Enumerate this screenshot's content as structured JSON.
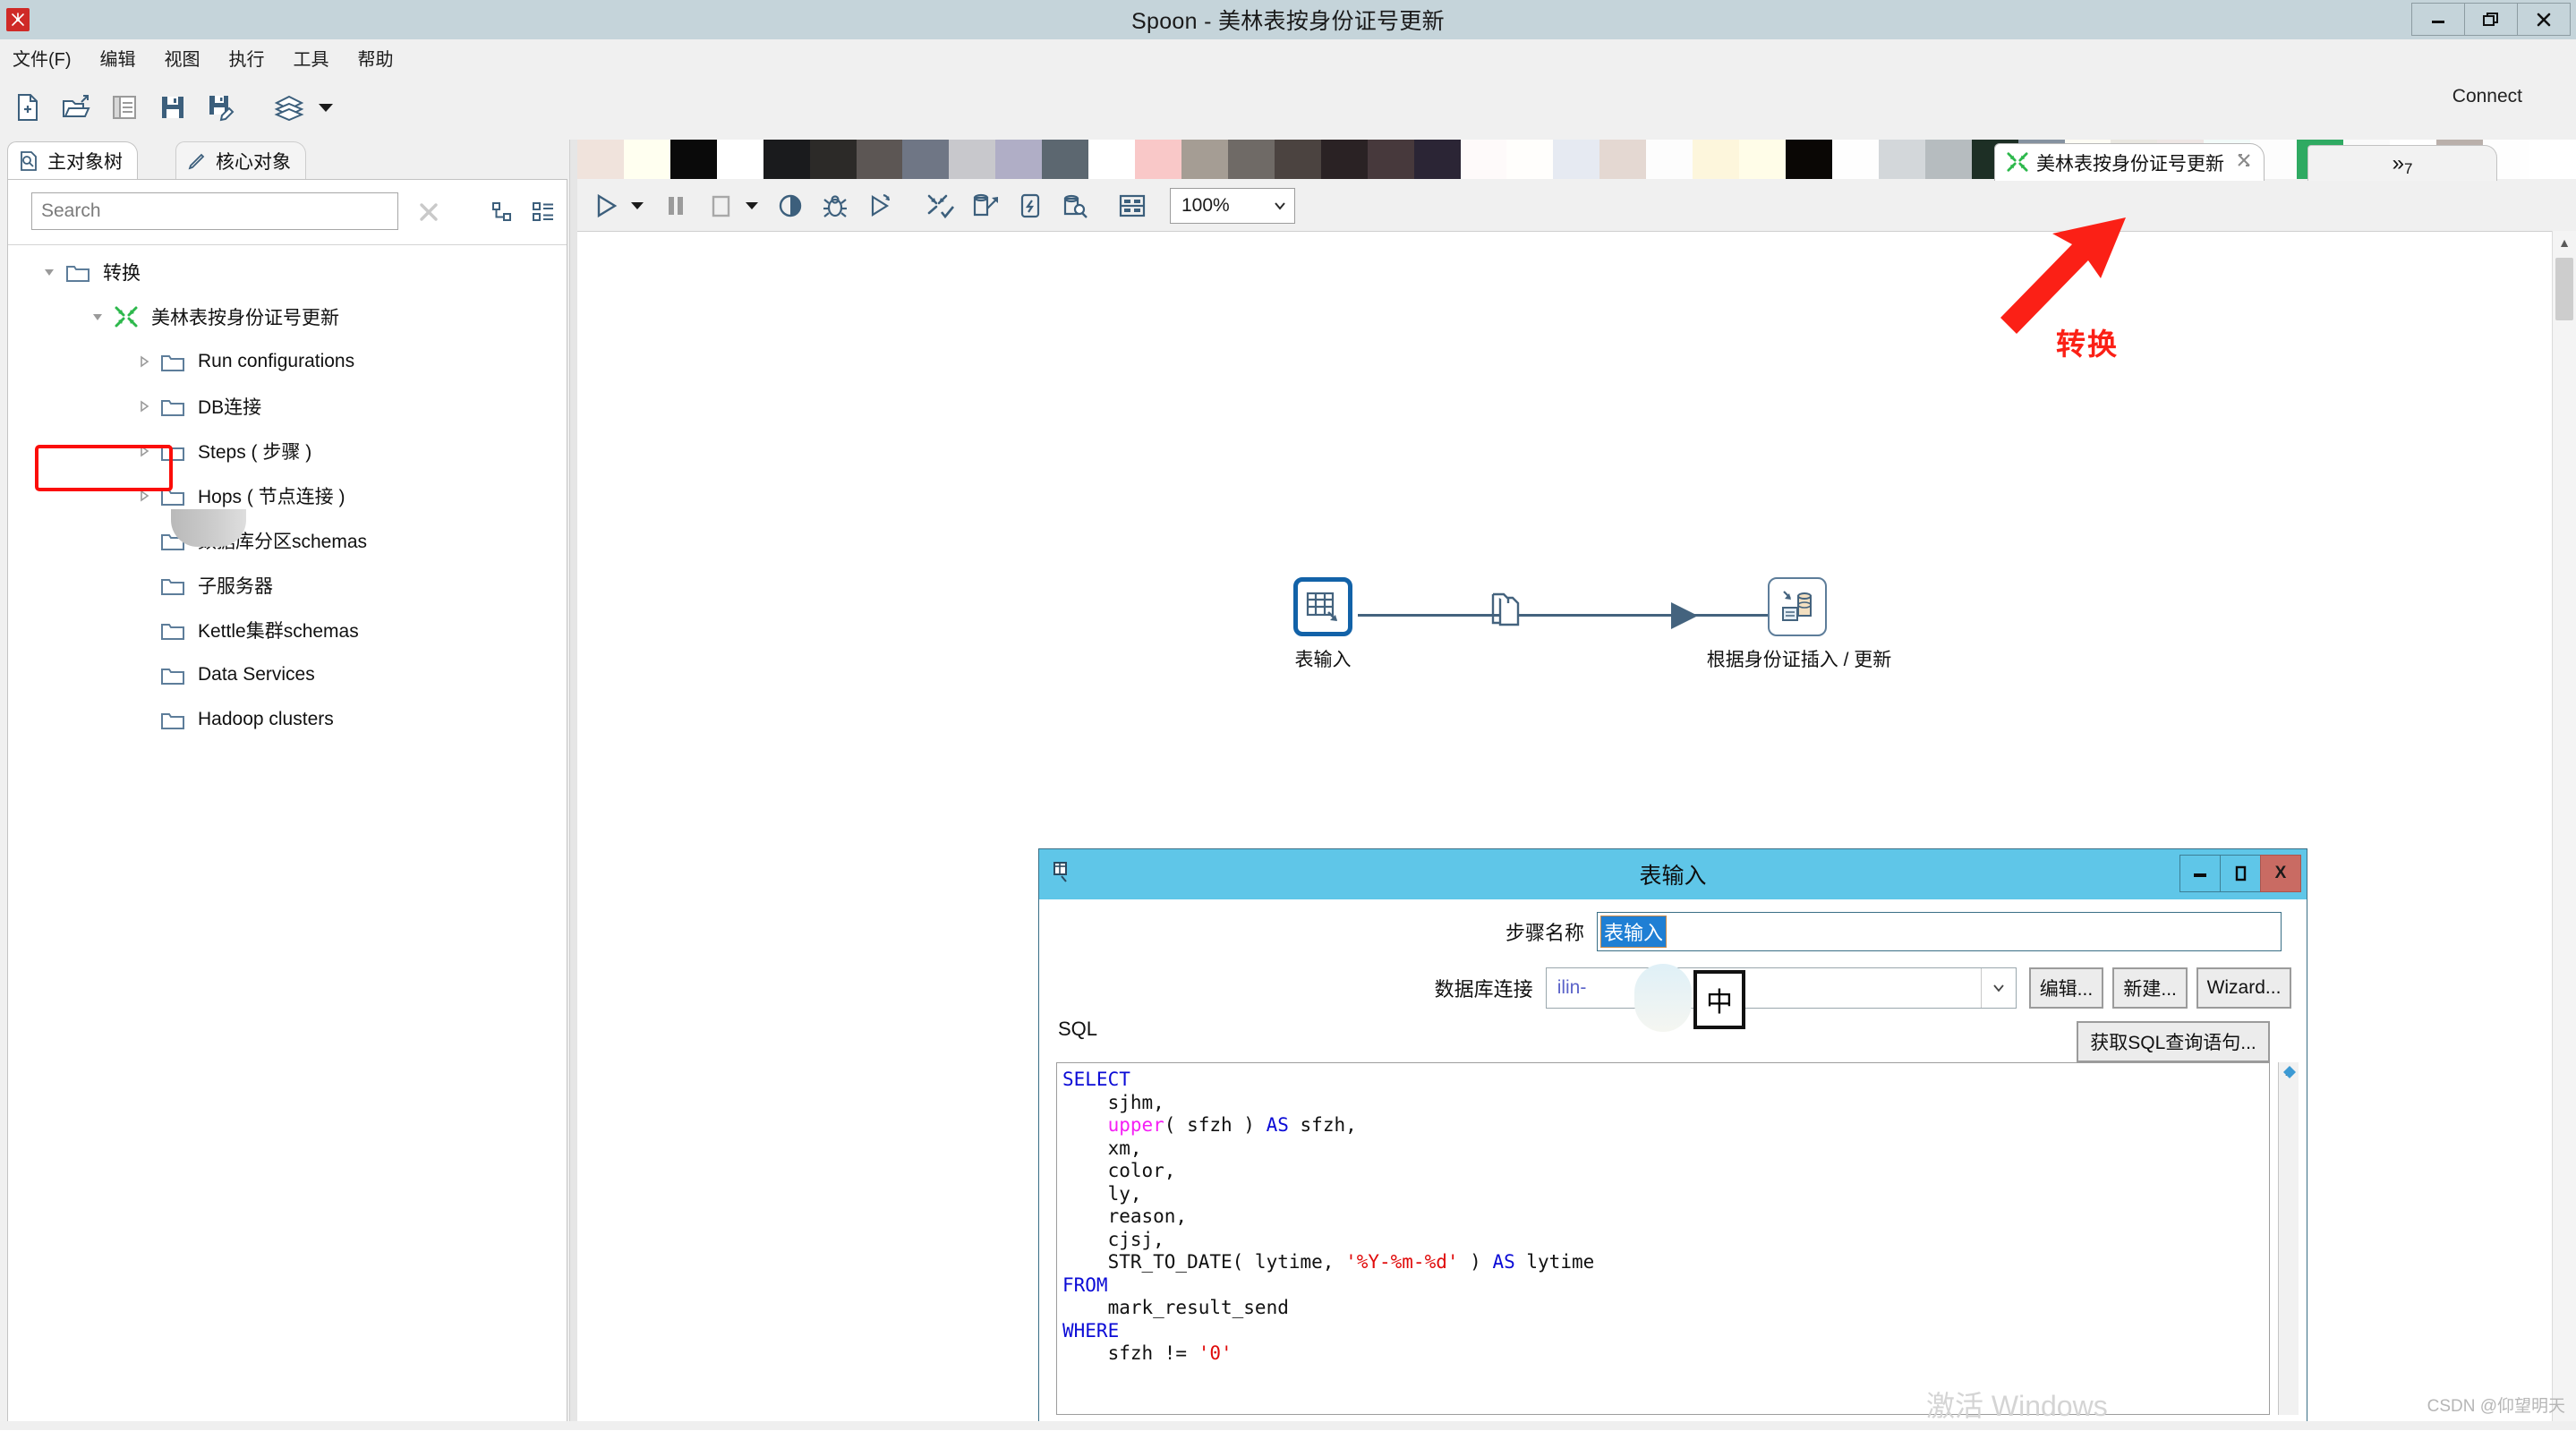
{
  "window": {
    "title": "Spoon - 美林表按身份证号更新",
    "logo_icon": "spoon-logo-icon",
    "minimize_label": "–",
    "maximize_label": "❐",
    "close_label": "✕"
  },
  "menu": {
    "items": [
      {
        "label": "文件(F)"
      },
      {
        "label": "编辑"
      },
      {
        "label": "视图"
      },
      {
        "label": "执行"
      },
      {
        "label": "工具"
      },
      {
        "label": "帮助"
      }
    ]
  },
  "toolbar": {
    "buttons": [
      {
        "icon": "new-file-icon",
        "label": "新建"
      },
      {
        "icon": "open-folder-icon",
        "label": "打开"
      },
      {
        "icon": "explorer-icon",
        "label": "资源库浏览"
      },
      {
        "icon": "save-icon",
        "label": "保存"
      },
      {
        "icon": "save-as-icon",
        "label": "另存为"
      },
      {
        "icon": "layers-icon",
        "label": "资源库"
      }
    ],
    "connect_label": "Connect"
  },
  "left_panel": {
    "tabs": [
      {
        "label": "主对象树",
        "icon": "document-search-icon",
        "active": true
      },
      {
        "label": "核心对象",
        "icon": "pencil-icon",
        "active": false
      }
    ],
    "search": {
      "placeholder": "Search",
      "value": "",
      "clear_icon": "clear-x-icon",
      "expand_icon": "expand-tree-icon",
      "collapse_icon": "collapse-tree-icon"
    },
    "tree": [
      {
        "label": "转换",
        "depth": 0,
        "icon": "folder-icon",
        "twisty": "expanded",
        "highlighted": true
      },
      {
        "label": "美林表按身份证号更新",
        "depth": 1,
        "icon": "transformation-icon",
        "twisty": "expanded",
        "blurred": true
      },
      {
        "label": "Run configurations",
        "depth": 2,
        "icon": "folder-icon",
        "twisty": "collapsed"
      },
      {
        "label": "DB连接",
        "depth": 2,
        "icon": "folder-icon",
        "twisty": "collapsed"
      },
      {
        "label": "Steps ( 步骤 )",
        "depth": 2,
        "icon": "folder-icon",
        "twisty": "collapsed"
      },
      {
        "label": "Hops ( 节点连接 )",
        "depth": 2,
        "icon": "folder-icon",
        "twisty": "collapsed"
      },
      {
        "label": "数据库分区schemas",
        "depth": 2,
        "icon": "folder-icon",
        "twisty": "none"
      },
      {
        "label": "子服务器",
        "depth": 2,
        "icon": "folder-icon",
        "twisty": "none"
      },
      {
        "label": "Kettle集群schemas",
        "depth": 2,
        "icon": "folder-icon",
        "twisty": "none"
      },
      {
        "label": "Data Services",
        "depth": 2,
        "icon": "folder-icon",
        "twisty": "none"
      },
      {
        "label": "Hadoop clusters",
        "depth": 2,
        "icon": "folder-icon",
        "twisty": "none"
      }
    ]
  },
  "editor": {
    "tab": {
      "label": "美林表按身份证号更新",
      "icon": "transformation-icon",
      "close_icon": "close-icon"
    },
    "overflow_tab": {
      "label": "»",
      "count": "7"
    },
    "transform_toolbar": {
      "run_icon": "run-icon",
      "run_dropdown_icon": "chevron-down-icon",
      "pause_icon": "pause-icon",
      "stop_icon": "stop-icon",
      "stop_dropdown_icon": "chevron-down-icon",
      "preview_icon": "preview-icon",
      "debug_icon": "debug-bug-icon",
      "replay_icon": "replay-icon",
      "verify_icon": "verify-icon",
      "impact_icon": "impact-analysis-icon",
      "sql_icon": "generate-sql-icon",
      "dbexplore_icon": "db-explorer-icon",
      "grid_icon": "show-grid-icon",
      "zoom_value": "100%",
      "zoom_caret": "chevron-down-icon"
    },
    "annotation": {
      "label": "转换",
      "arrow_icon": "red-arrow-icon",
      "color": "#fb2016"
    },
    "nodes": [
      {
        "id": "table-input",
        "label": "表输入",
        "icon": "table-input-icon",
        "selected": true
      },
      {
        "id": "insert-update",
        "label": "根据身份证插入 / 更新",
        "icon": "insert-update-icon",
        "selected": false
      }
    ],
    "hop": {
      "icon": "copy-rows-icon",
      "arrow_icon": "hop-arrow-icon"
    }
  },
  "dialog": {
    "title": "表输入",
    "title_icon": "table-input-small-icon",
    "minimize_label": "▬",
    "maximize_label": "❐",
    "close_label": "X",
    "step_name_label": "步骤名称",
    "step_name_value": "表输入",
    "connection_label": "数据库连接",
    "connection_value": "ilin-",
    "connection_caret": "chevron-down-icon",
    "ime_indicator": "中",
    "buttons": {
      "edit": "编辑...",
      "new": "新建...",
      "wizard": "Wizard...",
      "get_sql": "获取SQL查询语句..."
    },
    "sql_label": "SQL",
    "sql_lines": [
      [
        {
          "t": "SELECT",
          "c": "k"
        }
      ],
      [
        {
          "t": "    sjhm,",
          "c": ""
        }
      ],
      [
        {
          "t": "    ",
          "c": ""
        },
        {
          "t": "upper",
          "c": "fn"
        },
        {
          "t": "( sfzh ) ",
          "c": ""
        },
        {
          "t": "AS",
          "c": "k"
        },
        {
          "t": " sfzh,",
          "c": ""
        }
      ],
      [
        {
          "t": "    xm,",
          "c": ""
        }
      ],
      [
        {
          "t": "    color,",
          "c": ""
        }
      ],
      [
        {
          "t": "    ly,",
          "c": ""
        }
      ],
      [
        {
          "t": "    reason,",
          "c": ""
        }
      ],
      [
        {
          "t": "    cjsj,",
          "c": ""
        }
      ],
      [
        {
          "t": "    STR_TO_DATE( lytime, ",
          "c": ""
        },
        {
          "t": "'%Y-%m-%d'",
          "c": "s"
        },
        {
          "t": " ) ",
          "c": ""
        },
        {
          "t": "AS",
          "c": "k"
        },
        {
          "t": " lytime",
          "c": ""
        }
      ],
      [
        {
          "t": "FROM",
          "c": "k"
        }
      ],
      [
        {
          "t": "    mark_result_send",
          "c": ""
        }
      ],
      [
        {
          "t": "WHERE",
          "c": "k"
        }
      ],
      [
        {
          "t": "    sfzh != ",
          "c": ""
        },
        {
          "t": "'0'",
          "c": "s"
        }
      ]
    ]
  },
  "overlays": {
    "windows_watermark": "激活 Windows",
    "csdn_credit": "CSDN @仰望明天"
  },
  "colors": {
    "title_bar": "#c5d4da",
    "dialog_title": "#5fc6e8",
    "accent_blue": "#1262a8",
    "annotation_red": "#fb2016",
    "node_pill": "#d7e8f4"
  },
  "color_strip": [
    "#f0e3dc",
    "#fffff0",
    "#0a0a0a",
    "#ffffff",
    "#1a1b1d",
    "#2c2a28",
    "#5c5654",
    "#6f7685",
    "#c8c8cc",
    "#b0aec6",
    "#5c6770",
    "#ffffff",
    "#f9c8c8",
    "#a59d94",
    "#6f6a66",
    "#4b4340",
    "#2a2224",
    "#47393c",
    "#2b2535",
    "#fefafa",
    "#fffefc",
    "#e6eaf2",
    "#e4d8d2",
    "#fdfdfd",
    "#fdf6dc",
    "#fffde8",
    "#0a0705",
    "#fefefe",
    "#d3d7da",
    "#b6bcbf",
    "#1d2f25",
    "#8592a0",
    "#fdfcf4",
    "#e9e7e0",
    "#eee6e4",
    "#f2fbf9",
    "#fdfdfd",
    "#2faa62",
    "#fafafa",
    "#ffffff",
    "#bab0ab",
    "#fefefe",
    "#ffffff"
  ]
}
